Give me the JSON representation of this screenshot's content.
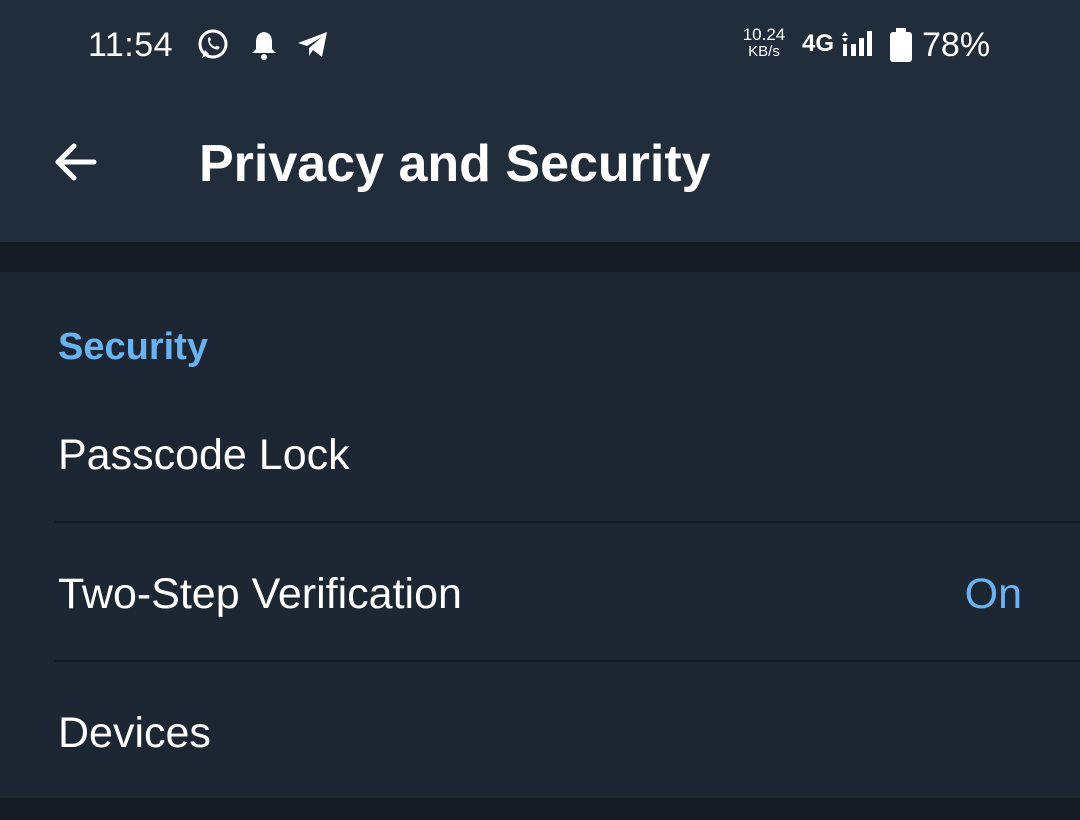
{
  "status_bar": {
    "time": "11:54",
    "notification_icons": [
      "whatsapp-icon",
      "bell-icon",
      "telegram-icon"
    ],
    "net_speed_value": "10.24",
    "net_speed_unit": "KB/s",
    "network_type": "4G",
    "battery_percent": "78%"
  },
  "app_bar": {
    "back_icon": "arrow-left-icon",
    "title": "Privacy and Security"
  },
  "security_section": {
    "header": "Security",
    "items": [
      {
        "label": "Passcode Lock",
        "value": ""
      },
      {
        "label": "Two-Step Verification",
        "value": "On"
      },
      {
        "label": "Devices",
        "value": ""
      }
    ]
  },
  "colors": {
    "background": "#1d2733",
    "bar": "#212d3b",
    "accent": "#6ab3f3",
    "separator": "#151c24"
  }
}
